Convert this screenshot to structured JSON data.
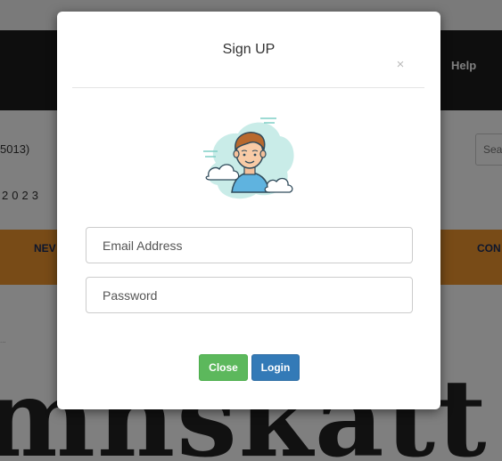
{
  "background": {
    "nav_help": "Help",
    "info_code": "5013)",
    "info_year": "2023",
    "search_placeholder": "Sea",
    "orange_nav_left": "NEV",
    "orange_nav_right": "CON",
    "breadcrumb": "...",
    "masthead_text": "mnskatt T"
  },
  "modal": {
    "title": "Sign UP",
    "close_icon": "×",
    "avatar_icon": "user-avatar-illustration",
    "email_placeholder": "Email Address",
    "password_placeholder": "Password",
    "close_button": "Close",
    "login_button": "Login"
  },
  "colors": {
    "close_button": "#5cb85c",
    "login_button": "#337ab7",
    "orange_bar": "#f0962f",
    "nav_bar": "#1d1d1d"
  }
}
